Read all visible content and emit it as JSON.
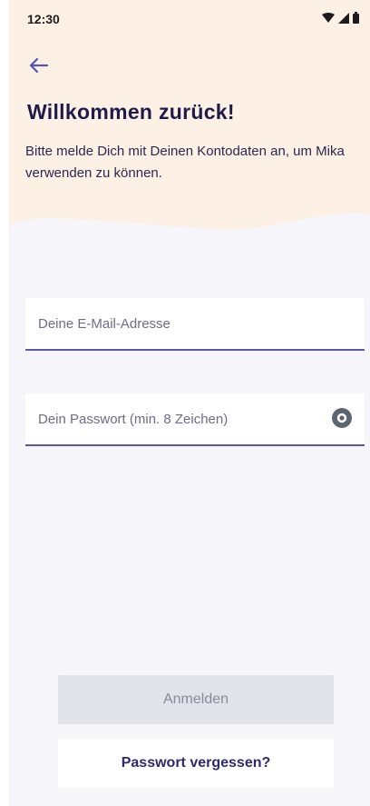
{
  "status_bar": {
    "time": "12:30",
    "icons": [
      "wifi-icon",
      "signal-icon",
      "battery-icon"
    ]
  },
  "header": {
    "back_icon": "arrow-left-icon",
    "title": "Willkommen zurück!",
    "subtitle": "Bitte melde Dich mit Deinen Kontodaten an, um Mika verwenden zu können."
  },
  "form": {
    "email": {
      "placeholder": "Deine E-Mail-Adresse",
      "value": ""
    },
    "password": {
      "placeholder": "Dein Passwort (min. 8 Zeichen)",
      "value": "",
      "toggle_icon": "eye-icon"
    }
  },
  "actions": {
    "login_label": "Anmelden",
    "forgot_label": "Passwort vergessen?"
  },
  "colors": {
    "accent": "#5a56b0",
    "title": "#1e1b4b",
    "hero_bg": "#fdf1e6",
    "screen_bg": "#f5f5fa",
    "button_disabled_bg": "#e2e2ea",
    "button_disabled_text": "#8a8a98"
  }
}
